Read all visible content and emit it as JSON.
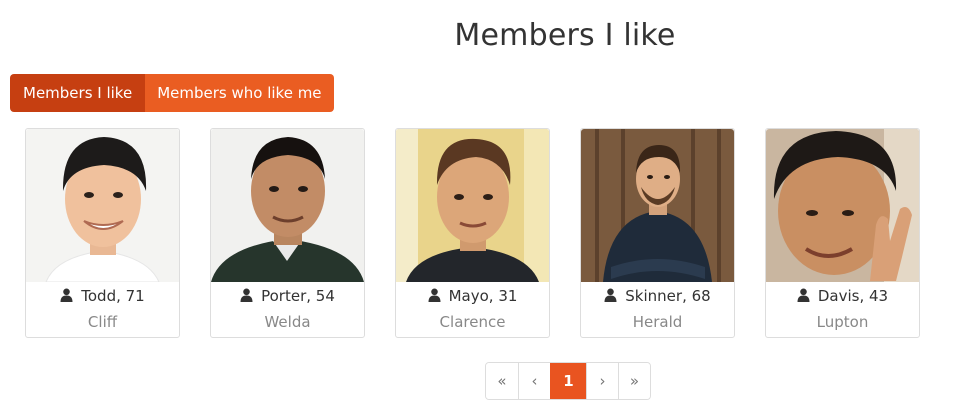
{
  "header": {
    "title": "Members I like"
  },
  "tabs": [
    {
      "label": "Members I like",
      "active": true
    },
    {
      "label": "Members who like me",
      "active": false
    }
  ],
  "members": [
    {
      "name_age": "Todd, 71",
      "city": "Cliff",
      "icon": "user-icon"
    },
    {
      "name_age": "Porter, 54",
      "city": "Welda",
      "icon": "user-icon"
    },
    {
      "name_age": "Mayo, 31",
      "city": "Clarence",
      "icon": "user-icon"
    },
    {
      "name_age": "Skinner, 68",
      "city": "Herald",
      "icon": "user-icon"
    },
    {
      "name_age": "Davis, 43",
      "city": "Lupton",
      "icon": "user-icon"
    }
  ],
  "pagination": {
    "first": "«",
    "prev": "‹",
    "current": "1",
    "next": "›",
    "last": "»"
  },
  "colors": {
    "accent": "#e95420",
    "accent_dark": "#c63f11",
    "muted_text": "#888888"
  }
}
